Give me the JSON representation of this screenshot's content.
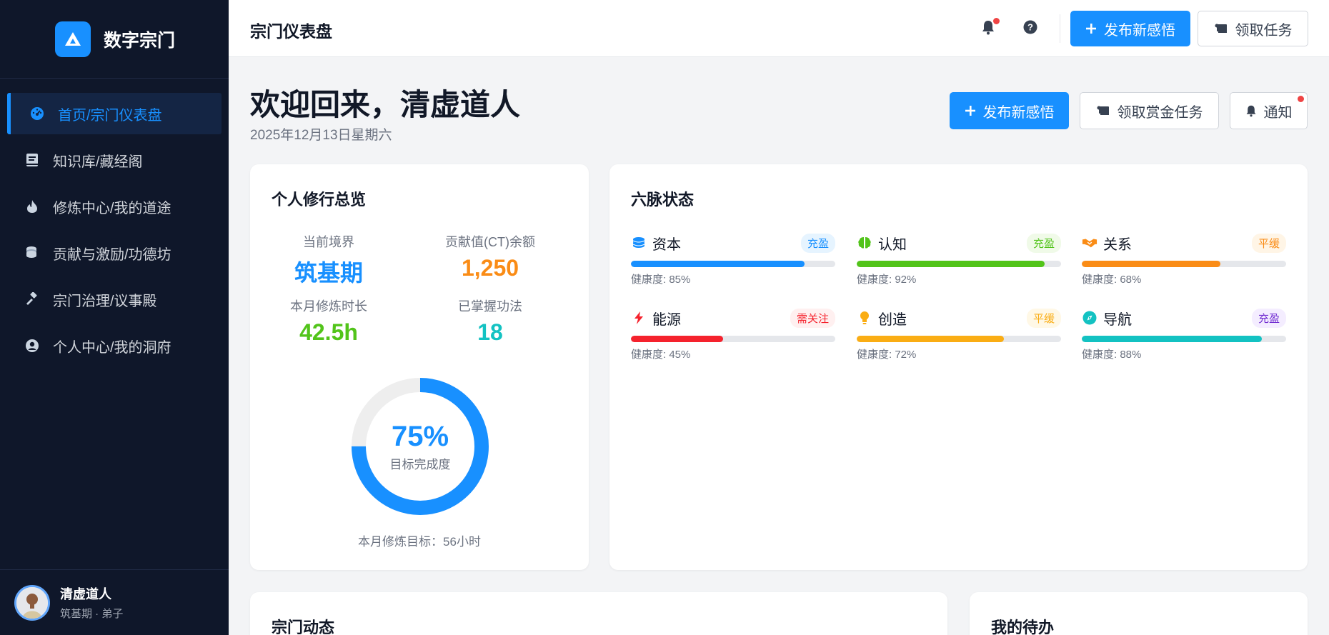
{
  "brand": {
    "name": "数字宗门"
  },
  "sidebar": {
    "items": [
      {
        "label": "首页/宗门仪表盘",
        "icon": "dashboard-icon",
        "active": true
      },
      {
        "label": "知识库/藏经阁",
        "icon": "book-icon"
      },
      {
        "label": "修炼中心/我的道途",
        "icon": "fire-icon"
      },
      {
        "label": "贡献与激励/功德坊",
        "icon": "coins-icon"
      },
      {
        "label": "宗门治理/议事殿",
        "icon": "gavel-icon"
      },
      {
        "label": "个人中心/我的洞府",
        "icon": "user-circle-icon"
      }
    ]
  },
  "user": {
    "name": "清虚道人",
    "sub": "筑基期 · 弟子"
  },
  "topbar": {
    "title": "宗门仪表盘",
    "publish_label": "发布新感悟",
    "task_label": "领取任务"
  },
  "main": {
    "welcome": "欢迎回来，清虚道人",
    "date": "2025年12月13日星期六",
    "publish_label": "发布新感悟",
    "bounty_label": "领取赏金任务",
    "notify_label": "通知"
  },
  "overview": {
    "title": "个人修行总览",
    "stats": [
      {
        "label": "当前境界",
        "value": "筑基期",
        "color": "#1890ff"
      },
      {
        "label": "贡献值(CT)余额",
        "value": "1,250",
        "color": "#fa8c16"
      },
      {
        "label": "本月修炼时长",
        "value": "42.5h",
        "color": "#52c41a"
      },
      {
        "label": "已掌握功法",
        "value": "18",
        "color": "#13c2c2"
      }
    ],
    "progress_pct": "75%",
    "progress_value": 0.75,
    "progress_label": "目标完成度",
    "goal_text": "本月修炼目标：56小时"
  },
  "meridians": {
    "title": "六脉状态",
    "items": [
      {
        "name": "资本",
        "tag": "充盈",
        "health": "健康度: 85%",
        "value": 0.85,
        "color": "#1890ff",
        "tag_color": "#1890ff",
        "tag_bg": "#e6f4ff",
        "icon": "coins-icon"
      },
      {
        "name": "认知",
        "tag": "充盈",
        "health": "健康度: 92%",
        "value": 0.92,
        "color": "#52c41a",
        "tag_color": "#52c41a",
        "tag_bg": "#f0fae8",
        "icon": "brain-icon"
      },
      {
        "name": "关系",
        "tag": "平缓",
        "health": "健康度: 68%",
        "value": 0.68,
        "color": "#fa8c16",
        "tag_color": "#fa8c16",
        "tag_bg": "#fff5e6",
        "icon": "handshake-icon"
      },
      {
        "name": "能源",
        "tag": "需关注",
        "health": "健康度: 45%",
        "value": 0.45,
        "color": "#f5222d",
        "tag_color": "#f5222d",
        "tag_bg": "#fff0f0",
        "icon": "bolt-icon"
      },
      {
        "name": "创造",
        "tag": "平缓",
        "health": "健康度: 72%",
        "value": 0.72,
        "color": "#faad14",
        "tag_color": "#faad14",
        "tag_bg": "#fff8e6",
        "icon": "lightbulb-icon"
      },
      {
        "name": "导航",
        "tag": "充盈",
        "health": "健康度: 88%",
        "value": 0.88,
        "color": "#13c2c2",
        "tag_color": "#722ed1",
        "tag_bg": "#f4edff",
        "icon": "compass-icon"
      }
    ]
  },
  "bottom": {
    "news_title": "宗门动态",
    "todo_title": "我的待办"
  }
}
